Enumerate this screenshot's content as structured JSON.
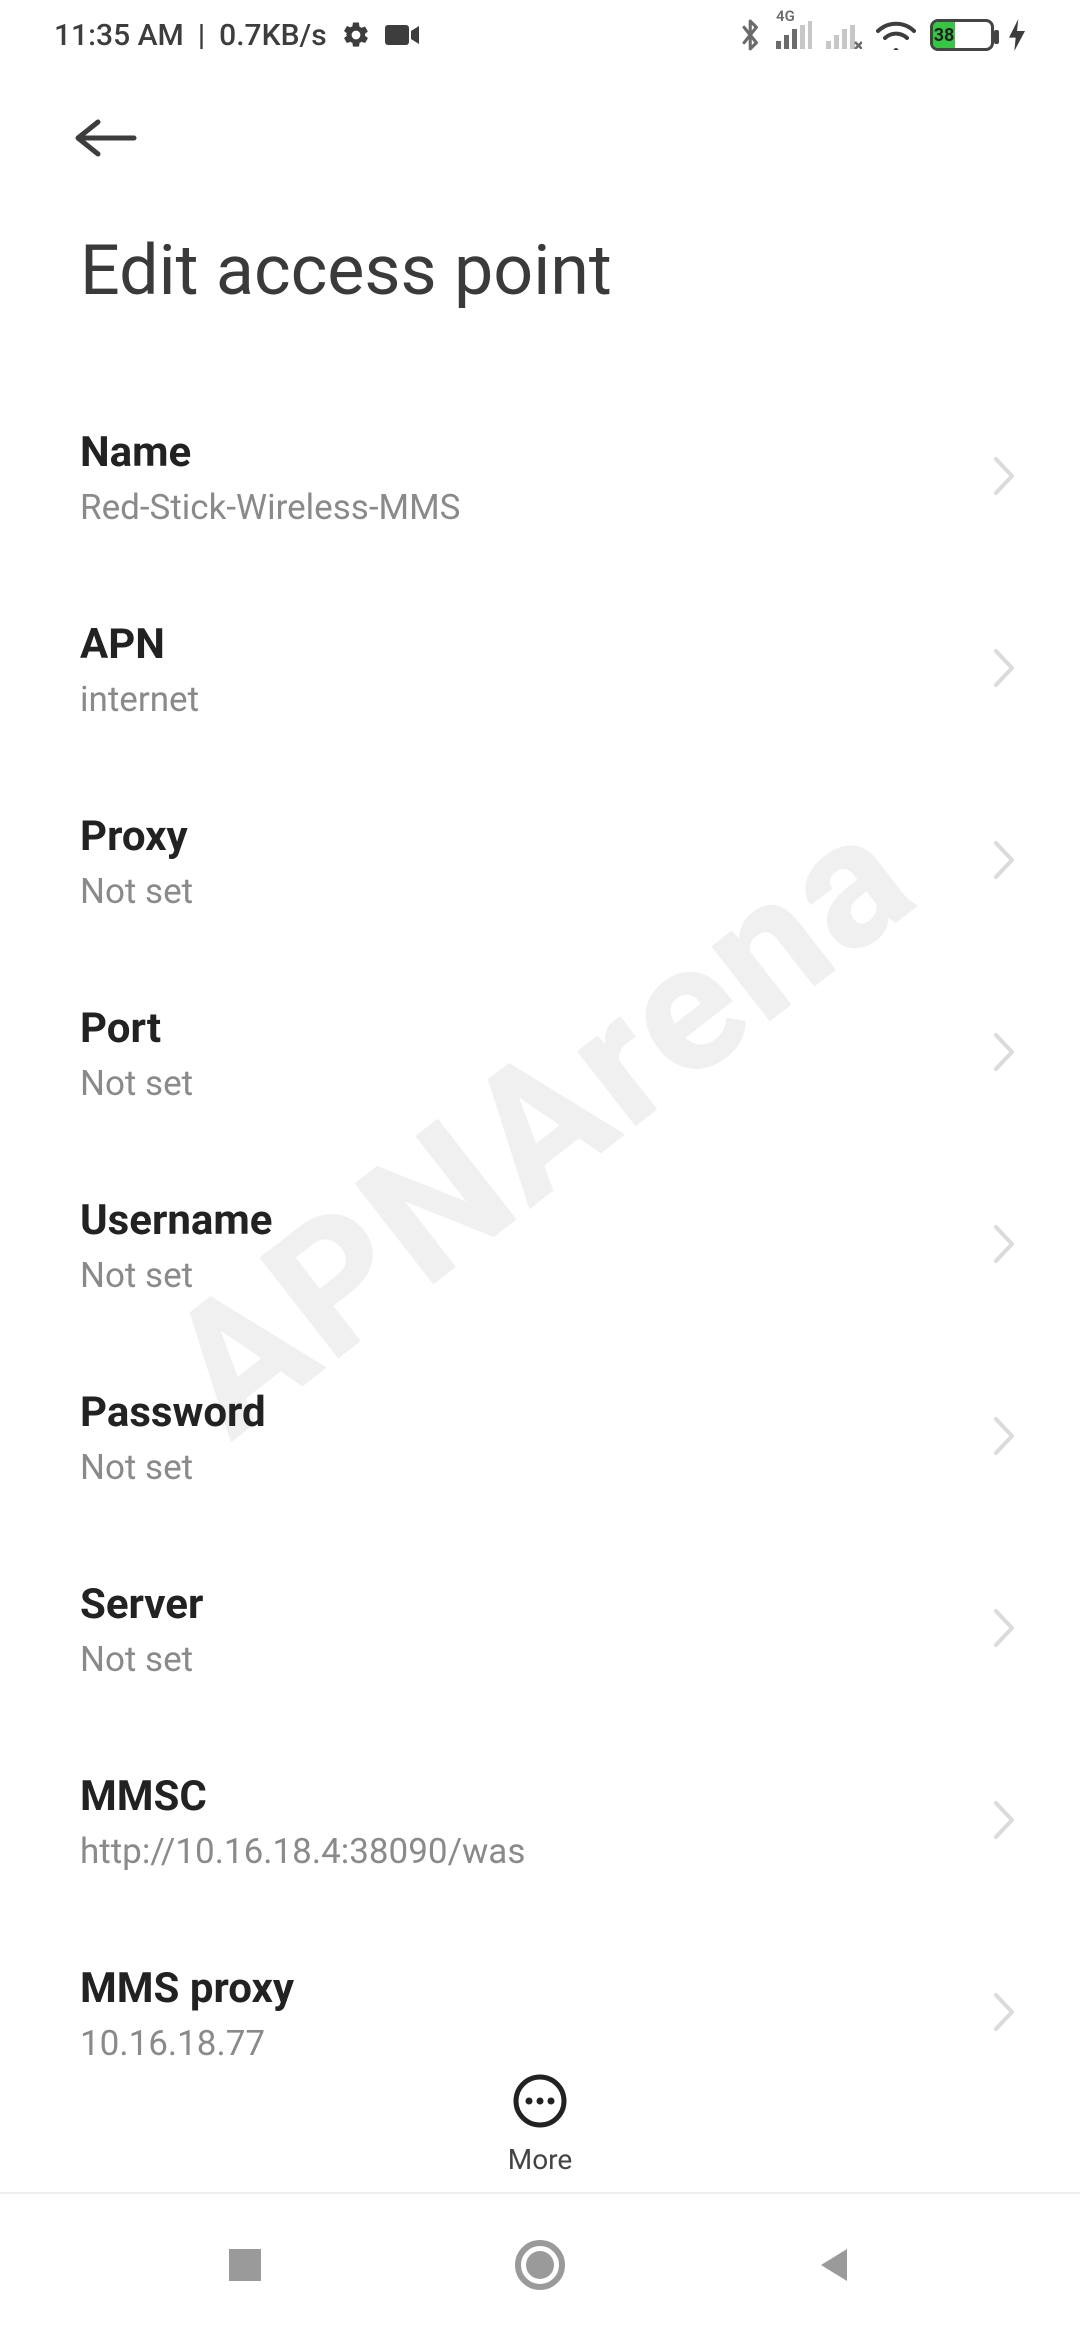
{
  "watermark": "APNArena",
  "statusbar": {
    "time": "11:35 AM",
    "separator": "|",
    "data_rate": "0.7KB/s",
    "battery_text": "38",
    "cell_label": "4G"
  },
  "header": {
    "title": "Edit access point"
  },
  "rows": [
    {
      "id": "name",
      "label": "Name",
      "value": "Red-Stick-Wireless-MMS"
    },
    {
      "id": "apn",
      "label": "APN",
      "value": "internet"
    },
    {
      "id": "proxy",
      "label": "Proxy",
      "value": "Not set"
    },
    {
      "id": "port",
      "label": "Port",
      "value": "Not set"
    },
    {
      "id": "username",
      "label": "Username",
      "value": "Not set"
    },
    {
      "id": "password",
      "label": "Password",
      "value": "Not set"
    },
    {
      "id": "server",
      "label": "Server",
      "value": "Not set"
    },
    {
      "id": "mmsc",
      "label": "MMSC",
      "value": "http://10.16.18.4:38090/was"
    },
    {
      "id": "mmsproxy",
      "label": "MMS proxy",
      "value": "10.16.18.77"
    }
  ],
  "more": {
    "label": "More"
  }
}
